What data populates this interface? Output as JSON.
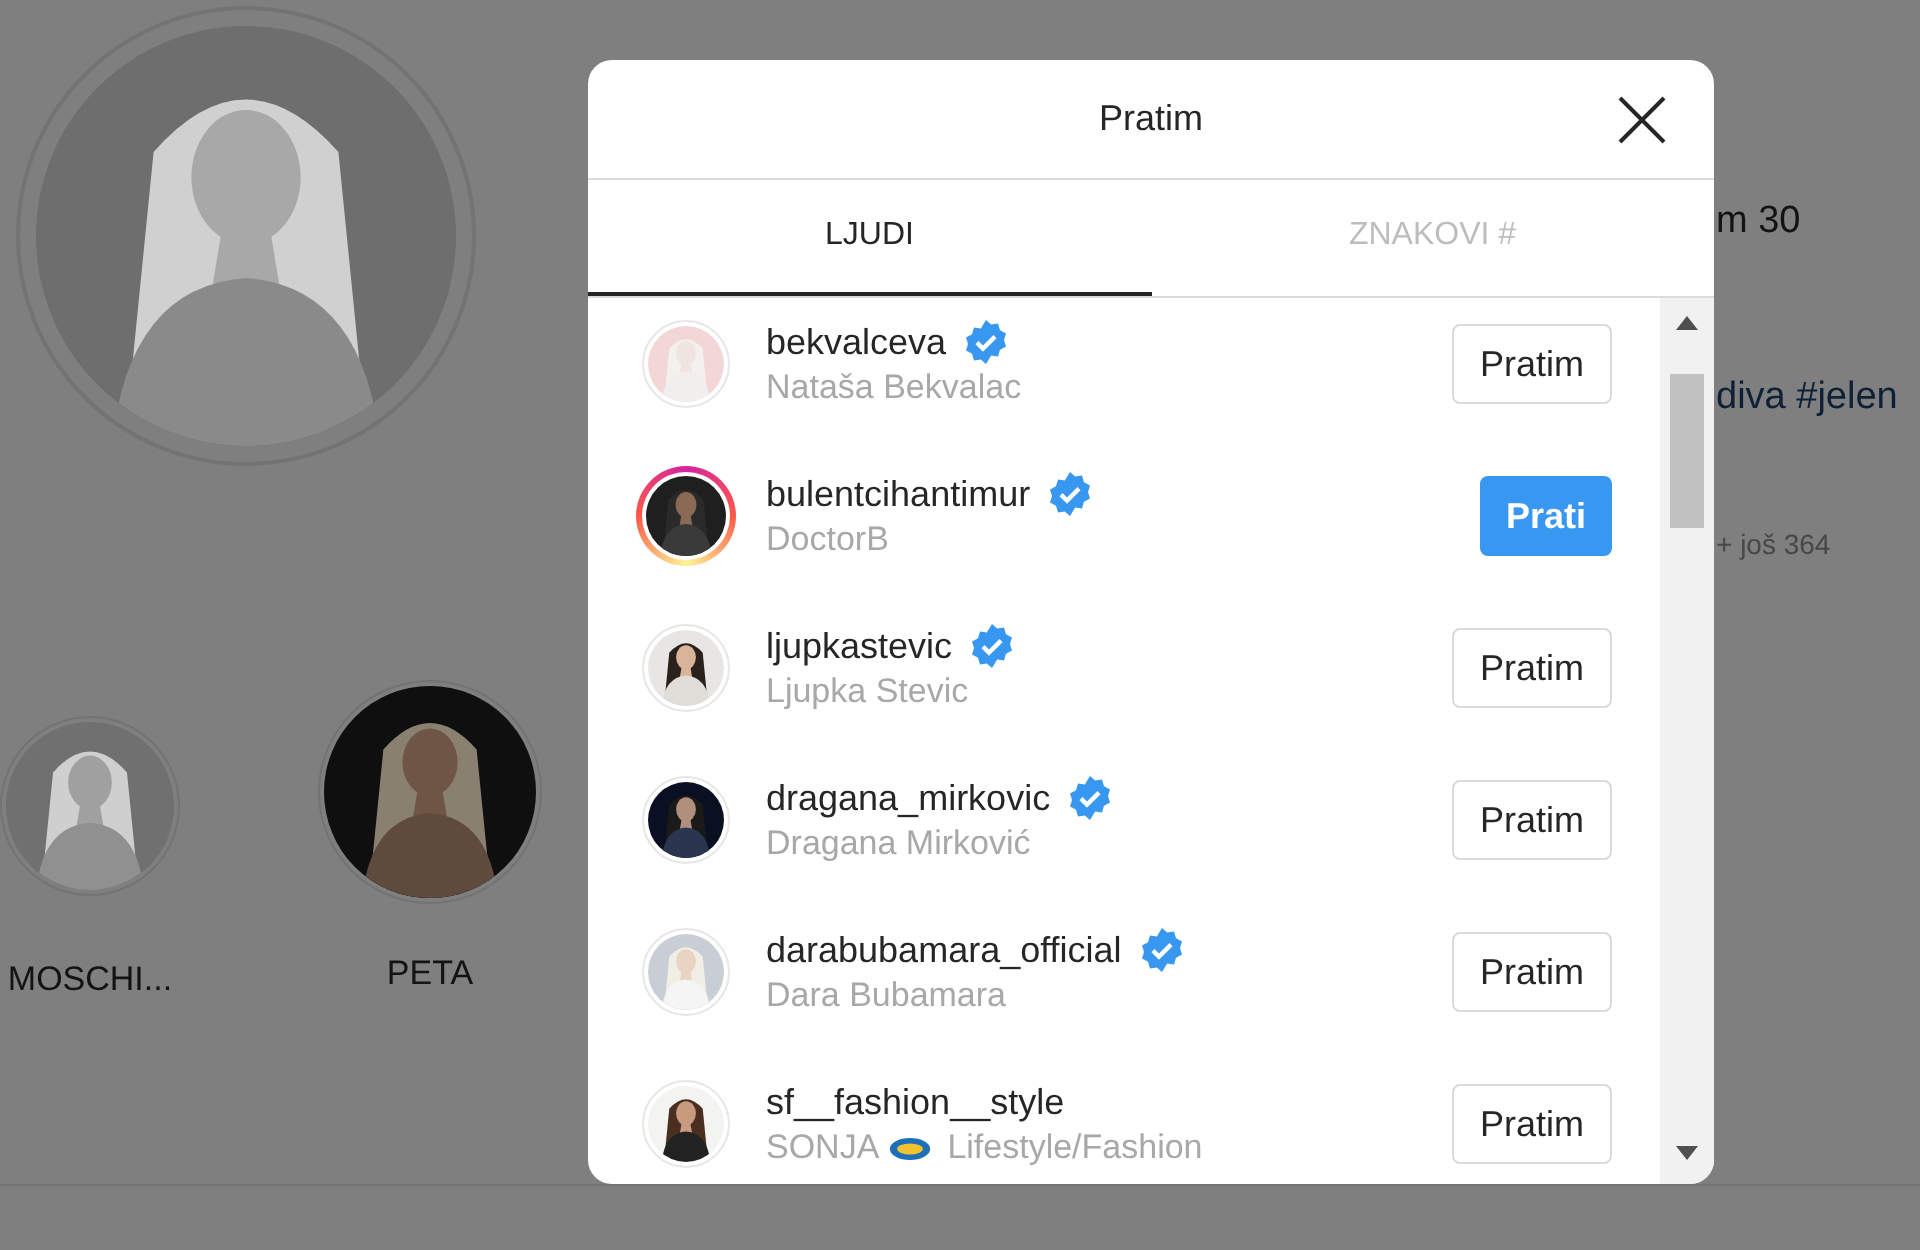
{
  "profile": {
    "stats_fragment": "m 30",
    "bio_fragment": "diva #jelen",
    "followed_by_more": "+ još 364",
    "highlights": [
      {
        "title": "MOSCHI..."
      },
      {
        "title": "PETA"
      }
    ]
  },
  "dialog": {
    "title": "Pratim",
    "tabs": [
      {
        "label": "LJUDI",
        "selected": true
      },
      {
        "label": "ZNAKOVI #",
        "selected": false
      }
    ],
    "accounts": [
      {
        "username": "bekvalceva",
        "verified": true,
        "story_ring": false,
        "full_name": "Nataša Bekvalac",
        "following": true,
        "button": "Pratim"
      },
      {
        "username": "bulentcihantimur",
        "verified": true,
        "story_ring": true,
        "full_name": "DoctorB",
        "following": false,
        "button": "Prati"
      },
      {
        "username": "ljupkastevic",
        "verified": true,
        "story_ring": false,
        "full_name": "Ljupka Stevic",
        "following": true,
        "button": "Pratim"
      },
      {
        "username": "dragana_mirkovic",
        "verified": true,
        "story_ring": false,
        "full_name": "Dragana Mirković",
        "following": true,
        "button": "Pratim"
      },
      {
        "username": "darabubamara_official",
        "verified": true,
        "story_ring": false,
        "full_name": "Dara Bubamara",
        "following": true,
        "button": "Pratim"
      },
      {
        "username": "sf__fashion__style",
        "verified": false,
        "story_ring": false,
        "full_name": "SONJA",
        "emoji": true,
        "category": "Lifestyle/Fashion",
        "following": true,
        "button": "Pratim"
      }
    ]
  }
}
